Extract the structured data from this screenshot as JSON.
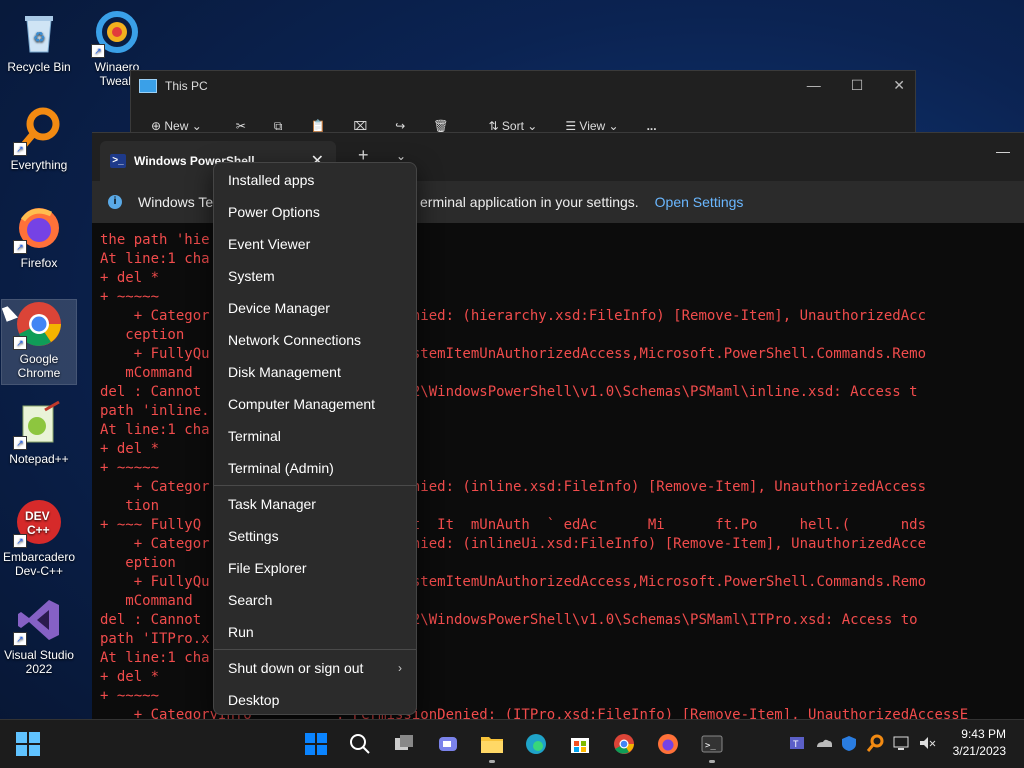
{
  "desktop": {
    "icons": [
      {
        "label": "Recycle Bin"
      },
      {
        "label": "Winaero Tweak"
      },
      {
        "label": "Everything"
      },
      {
        "label": "Firefox"
      },
      {
        "label": "Google Chrome"
      },
      {
        "label": "Notepad++"
      },
      {
        "label": "Embarcadero Dev-C++"
      },
      {
        "label": "Visual Studio 2022"
      }
    ]
  },
  "this_pc": {
    "title": "This PC",
    "toolbar": {
      "new": "New",
      "sort": "Sort",
      "view": "View",
      "more": "..."
    }
  },
  "terminal": {
    "tab_title": "Windows PowerShell",
    "info_left": "Windows Te",
    "info_right": "erminal application in your settings.",
    "open_settings": "Open Settings",
    "lines": [
      "the path 'hie",
      "At line:1 cha",
      "+ del *",
      "+ ~~~~~",
      "    + Categor                 ssionDenied: (hierarchy.xsd:FileInfo) [Remove-Item], UnauthorizedAcc",
      "   ception",
      "    + FullyQu                 eFileSystemItemUnAuthorizedAccess,Microsoft.PowerShell.Commands.Remo",
      "   mCommand",
      "del : Cannot                 \\System32\\WindowsPowerShell\\v1.0\\Schemas\\PSMaml\\inline.xsd: Access t",
      "path 'inline.",
      "At line:1 cha",
      "+ del *",
      "+ ~~~~~",
      "    + Categor                 ssionDenied: (inline.xsd:FileInfo) [Remove-Item], UnauthorizedAccess",
      "   tion",
      "+ ~~~ FullyQ                 eFileSvst  It  mUnAuth  ` edAc      Mi      ft.Po     hell.(      nds",
      "    + Categor                 ssionDenied: (inlineUi.xsd:FileInfo) [Remove-Item], UnauthorizedAcce",
      "   eption",
      "    + FullyQu                 eFileSystemItemUnAuthorizedAccess,Microsoft.PowerShell.Commands.Remo",
      "   mCommand",
      "del : Cannot                 \\System32\\WindowsPowerShell\\v1.0\\Schemas\\PSMaml\\ITPro.xsd: Access to",
      "path 'ITPro.x",
      "At line:1 cha",
      "+ del *",
      "+ ~~~~~",
      "    + CategoryInfo          : PermissionDenied: (ITPro.xsd:FileInfo) [Remove-Item], UnauthorizedAccessE"
    ]
  },
  "context_menu": {
    "group1": [
      "Installed apps",
      "Power Options",
      "Event Viewer",
      "System",
      "Device Manager",
      "Network Connections",
      "Disk Management",
      "Computer Management",
      "Terminal",
      "Terminal (Admin)"
    ],
    "group2": [
      "Task Manager",
      "Settings",
      "File Explorer",
      "Search",
      "Run"
    ],
    "group3": [
      "Shut down or sign out",
      "Desktop"
    ]
  },
  "taskbar": {
    "time": "9:43 PM",
    "date": "3/21/2023"
  },
  "colors": {
    "accent": "#0078d4",
    "console_error": "#f14c4c",
    "link": "#6ab7ff"
  }
}
